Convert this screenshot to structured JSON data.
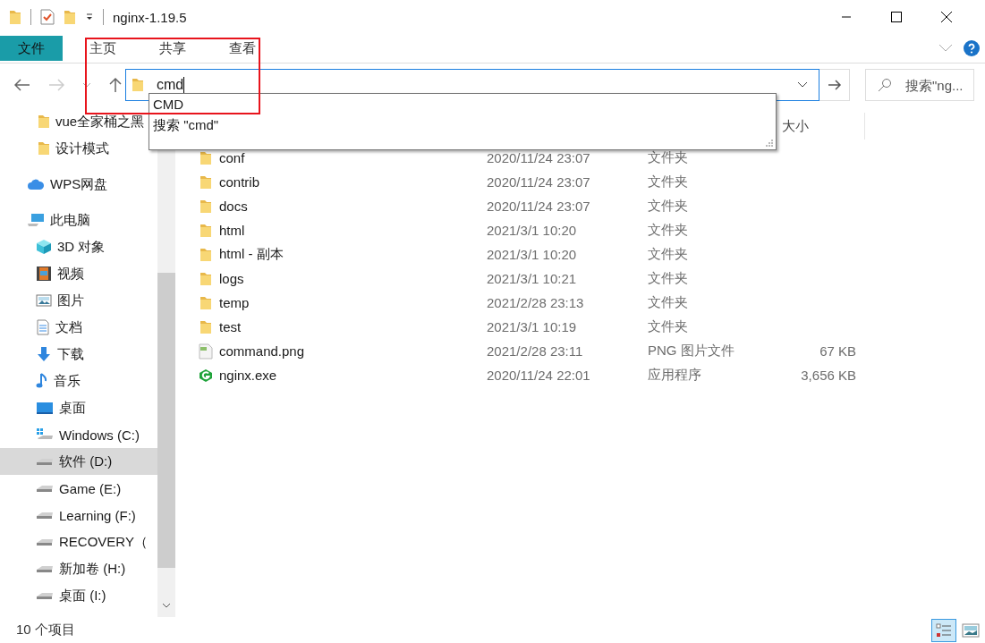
{
  "window": {
    "title": "nginx-1.19.5"
  },
  "ribbon_tabs": [
    {
      "label": "文件",
      "selected": true
    },
    {
      "label": "主页",
      "selected": false
    },
    {
      "label": "共享",
      "selected": false
    },
    {
      "label": "查看",
      "selected": false
    }
  ],
  "address": {
    "value": "cmd",
    "suggestions": [
      "CMD",
      "搜索 \"cmd\""
    ]
  },
  "search": {
    "placeholder": "搜索\"ng..."
  },
  "sidebar": {
    "groups": [
      {
        "items": [
          {
            "label": "vue全家桶之黑",
            "kind": "folder",
            "selected": false
          },
          {
            "label": "设计模式",
            "kind": "folder",
            "selected": false
          }
        ]
      },
      {
        "items": [
          {
            "label": "WPS网盘",
            "kind": "cloud",
            "selected": false
          }
        ]
      },
      {
        "items": [
          {
            "label": "此电脑",
            "kind": "computer",
            "selected": false,
            "children": [
              {
                "label": "3D 对象",
                "kind": "cube",
                "selected": false
              },
              {
                "label": "视频",
                "kind": "video",
                "selected": false
              },
              {
                "label": "图片",
                "kind": "picture",
                "selected": false
              },
              {
                "label": "文档",
                "kind": "document",
                "selected": false
              },
              {
                "label": "下载",
                "kind": "download",
                "selected": false
              },
              {
                "label": "音乐",
                "kind": "music",
                "selected": false
              },
              {
                "label": "桌面",
                "kind": "desktop",
                "selected": false
              },
              {
                "label": "Windows (C:)",
                "kind": "system-drive",
                "selected": false
              },
              {
                "label": "软件 (D:)",
                "kind": "drive",
                "selected": true
              },
              {
                "label": "Game (E:)",
                "kind": "drive",
                "selected": false
              },
              {
                "label": "Learning (F:)",
                "kind": "drive",
                "selected": false
              },
              {
                "label": "RECOVERY（",
                "kind": "drive",
                "selected": false
              },
              {
                "label": "新加卷 (H:)",
                "kind": "drive",
                "selected": false
              },
              {
                "label": "桌面 (I:)",
                "kind": "drive",
                "selected": false
              }
            ]
          }
        ]
      }
    ]
  },
  "table": {
    "columns": [
      "大小"
    ],
    "rows": [
      {
        "name": "conf",
        "kind": "folder",
        "date": "2020/11/24 23:07",
        "type": "文件夹"
      },
      {
        "name": "contrib",
        "kind": "folder",
        "date": "2020/11/24 23:07",
        "type": "文件夹"
      },
      {
        "name": "docs",
        "kind": "folder",
        "date": "2020/11/24 23:07",
        "type": "文件夹"
      },
      {
        "name": "html",
        "kind": "folder",
        "date": "2021/3/1 10:20",
        "type": "文件夹"
      },
      {
        "name": "html - 副本",
        "kind": "folder",
        "date": "2021/3/1 10:20",
        "type": "文件夹"
      },
      {
        "name": "logs",
        "kind": "folder",
        "date": "2021/3/1 10:21",
        "type": "文件夹"
      },
      {
        "name": "temp",
        "kind": "folder",
        "date": "2021/2/28 23:13",
        "type": "文件夹"
      },
      {
        "name": "test",
        "kind": "folder",
        "date": "2021/3/1 10:19",
        "type": "文件夹"
      },
      {
        "name": "command.png",
        "kind": "image",
        "date": "2021/2/28 23:11",
        "type": "PNG 图片文件",
        "size": "67 KB"
      },
      {
        "name": "nginx.exe",
        "kind": "app",
        "date": "2020/11/24 22:01",
        "type": "应用程序",
        "size": "3,656 KB"
      }
    ]
  },
  "status_bar": {
    "item_count": "10 个项目",
    "views": [
      {
        "kind": "details",
        "selected": true
      },
      {
        "kind": "thumbnails",
        "selected": false
      }
    ]
  }
}
